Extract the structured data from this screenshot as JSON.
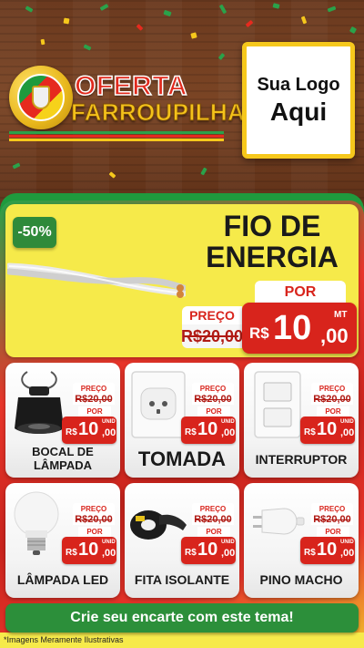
{
  "header": {
    "title_line1": "OFERTA",
    "title_line2": "FARROUPILHA",
    "logo_placeholder_line1": "Sua Logo",
    "logo_placeholder_line2": "Aqui"
  },
  "featured": {
    "discount": "-50%",
    "title_line1": "FIO DE",
    "title_line2": "ENERGIA",
    "por_label": "POR",
    "preco_label": "PREÇO",
    "old_price": "R$20,00",
    "currency": "R$",
    "price_int": "10",
    "price_dec": ",00",
    "unit": "MT"
  },
  "products": [
    {
      "name": "BOCAL DE LÂMPADA",
      "preco_label": "PREÇO",
      "old_price": "R$20,00",
      "por_label": "POR",
      "currency": "R$",
      "price_int": "10",
      "price_dec": ",00",
      "unit": "UNID",
      "icon": "lamp-socket-icon"
    },
    {
      "name": "TOMADA",
      "preco_label": "PREÇO",
      "old_price": "R$20,00",
      "por_label": "POR",
      "currency": "R$",
      "price_int": "10",
      "price_dec": ",00",
      "unit": "UNID",
      "icon": "outlet-icon"
    },
    {
      "name": "INTERRUPTOR",
      "preco_label": "PREÇO",
      "old_price": "R$20,00",
      "por_label": "POR",
      "currency": "R$",
      "price_int": "10",
      "price_dec": ",00",
      "unit": "UNID",
      "icon": "switch-icon"
    },
    {
      "name": "LÂMPADA LED",
      "preco_label": "PREÇO",
      "old_price": "R$20,00",
      "por_label": "POR",
      "currency": "R$",
      "price_int": "10",
      "price_dec": ",00",
      "unit": "UNID",
      "icon": "led-bulb-icon"
    },
    {
      "name": "FITA ISOLANTE",
      "preco_label": "PREÇO",
      "old_price": "R$20,00",
      "por_label": "POR",
      "currency": "R$",
      "price_int": "10",
      "price_dec": ",00",
      "unit": "UNID",
      "icon": "tape-icon"
    },
    {
      "name": "PINO MACHO",
      "preco_label": "PREÇO",
      "old_price": "R$20,00",
      "por_label": "POR",
      "currency": "R$",
      "price_int": "10",
      "price_dec": ",00",
      "unit": "UNID",
      "icon": "plug-icon"
    }
  ],
  "cta": {
    "label": "Crie seu encarte com este tema!"
  },
  "footer": {
    "disclaimer": "*Imagens Meramente Ilustrativas"
  },
  "colors": {
    "green": "#2c8f3a",
    "red": "#d8241c",
    "yellow": "#f6ea4a",
    "wood": "#6b3a1f"
  }
}
